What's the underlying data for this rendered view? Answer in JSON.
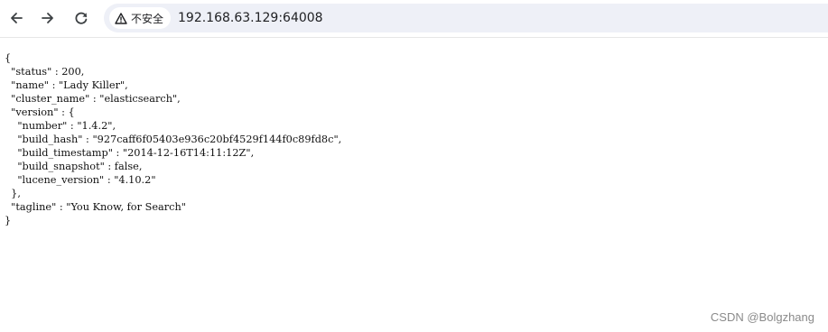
{
  "toolbar": {
    "back_icon": "arrow-left-icon",
    "forward_icon": "arrow-right-icon",
    "reload_icon": "reload-icon",
    "security_icon": "warning-triangle-icon",
    "security_label": "不安全",
    "url": "192.168.63.129:64008"
  },
  "page": {
    "json_lines": [
      "{",
      "  \"status\" : 200,",
      "  \"name\" : \"Lady Killer\",",
      "  \"cluster_name\" : \"elasticsearch\",",
      "  \"version\" : {",
      "    \"number\" : \"1.4.2\",",
      "    \"build_hash\" : \"927caff6f05403e936c20bf4529f144f0c89fd8c\",",
      "    \"build_timestamp\" : \"2014-12-16T14:11:12Z\",",
      "    \"build_snapshot\" : false,",
      "    \"lucene_version\" : \"4.10.2\"",
      "  },",
      "  \"tagline\" : \"You Know, for Search\"",
      "}"
    ]
  },
  "watermark": "CSDN @Bolgzhang"
}
